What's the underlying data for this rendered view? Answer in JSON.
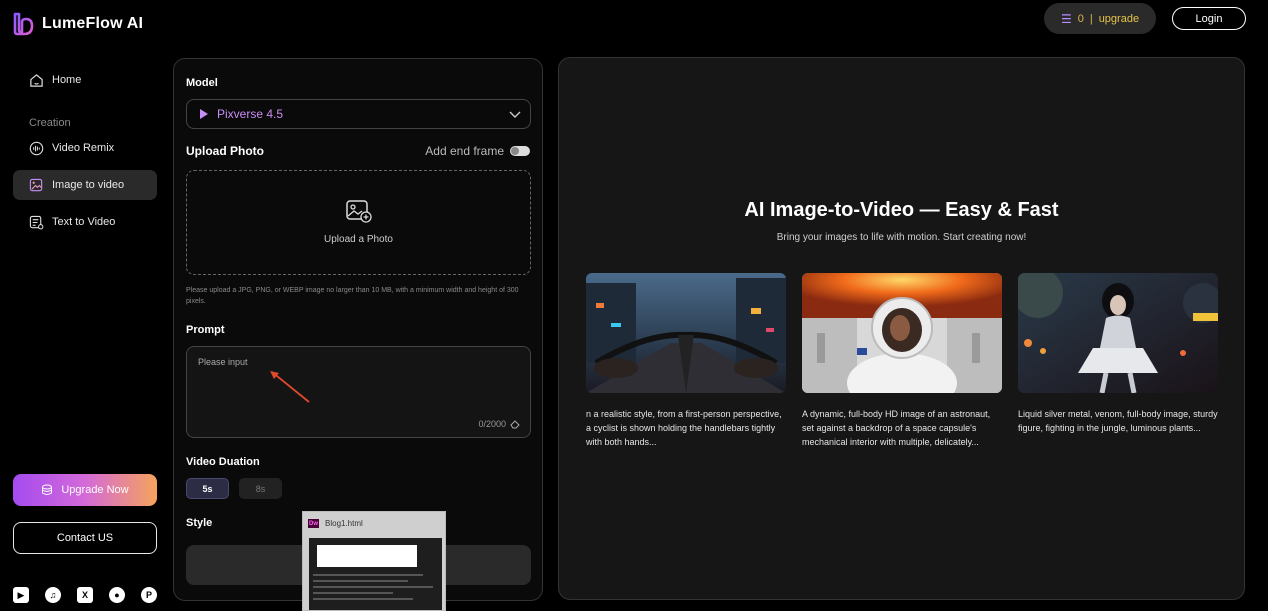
{
  "app": {
    "name": "LumeFlow AI",
    "credits_count": "0",
    "credits_sep": "|",
    "upgrade_link": "upgrade",
    "login_label": "Login"
  },
  "sidebar": {
    "home": "Home",
    "section_label": "Creation",
    "items": [
      {
        "label": "Video Remix",
        "icon": "waveform-icon"
      },
      {
        "label": "Image to video",
        "icon": "image-video-icon"
      },
      {
        "label": "Text to Video",
        "icon": "text-video-icon"
      }
    ],
    "active_item": "Image to video",
    "upgrade_now": "Upgrade Now",
    "contact": "Contact US",
    "socials": [
      "youtube-icon",
      "tiktok-icon",
      "x-icon",
      "reddit-icon",
      "pinterest-icon"
    ]
  },
  "form": {
    "model_label": "Model",
    "model_value": "Pixverse 4.5",
    "upload_label": "Upload Photo",
    "end_frame_label": "Add end frame",
    "end_frame_on": false,
    "upload_cta": "Upload a Photo",
    "upload_hint": "Please upload a JPG, PNG, or WEBP image no larger than 10 MB, with a minimum width and height of 300 pixels.",
    "prompt_label": "Prompt",
    "prompt_placeholder": "Please input",
    "prompt_count": "0/2000",
    "duration_label": "Video Duation",
    "durations": [
      "5s",
      "8s"
    ],
    "selected_duration": "5s",
    "style_label": "Style"
  },
  "taskbar_preview": {
    "title": "Blog1.html",
    "app_badge": "Dw"
  },
  "showcase": {
    "title": "AI Image-to-Video — Easy & Fast",
    "subtitle": "Bring your images to life with motion. Start creating now!",
    "cards": [
      {
        "desc": "n a realistic style, from a first-person perspective, a cyclist is shown holding the handlebars tightly with both hands..."
      },
      {
        "desc": "A dynamic, full-body HD image of an astronaut, set against a backdrop of a space capsule's mechanical interior with multiple, delicately..."
      },
      {
        "desc": "Liquid silver metal, venom, full-body image, sturdy figure, fighting in the jungle, luminous plants..."
      }
    ]
  },
  "colors": {
    "accent_purple": "#c98ef5",
    "upgrade_gold": "#e6c34a",
    "gradient_start": "#a54bf0",
    "gradient_end": "#f5a35c"
  }
}
